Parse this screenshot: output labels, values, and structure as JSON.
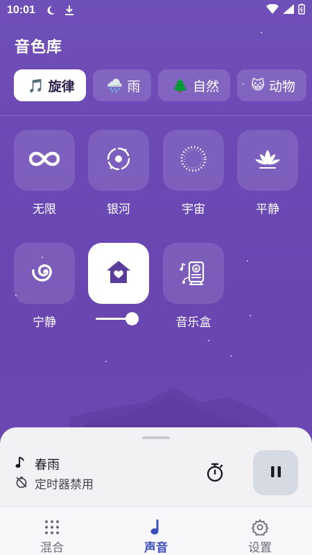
{
  "status_bar": {
    "time": "10:01"
  },
  "page_title": "音色库",
  "tabs": [
    {
      "emoji": "🎵",
      "label": "旋律",
      "active": true
    },
    {
      "emoji": "🌧️",
      "label": "雨",
      "active": false
    },
    {
      "emoji": "🌲",
      "label": "自然",
      "active": false
    },
    {
      "emoji": "😺",
      "label": "动物",
      "active": false
    }
  ],
  "sounds": [
    {
      "label": "无限",
      "icon": "infinity-icon"
    },
    {
      "label": "银河",
      "icon": "galaxy-icon"
    },
    {
      "label": "宇宙",
      "icon": "universe-ring-icon"
    },
    {
      "label": "平静",
      "icon": "lotus-icon"
    },
    {
      "label": "宁静",
      "icon": "spiral-icon"
    },
    {
      "label": "",
      "icon": "house-heart-icon",
      "selected": true,
      "volume": 0.85
    },
    {
      "label": "音乐盒",
      "icon": "music-box-icon"
    }
  ],
  "now_playing": {
    "title": "春雨",
    "timer_status": "定时器禁用"
  },
  "bottom_nav": [
    {
      "label": "混合",
      "icon": "grid-dots-icon",
      "active": false
    },
    {
      "label": "声音",
      "icon": "music-note-icon",
      "active": true
    },
    {
      "label": "设置",
      "icon": "gear-icon",
      "active": false
    }
  ],
  "colors": {
    "background": "#6b49b4",
    "accent": "#3b4db8",
    "sheet": "#f2f2f4"
  }
}
